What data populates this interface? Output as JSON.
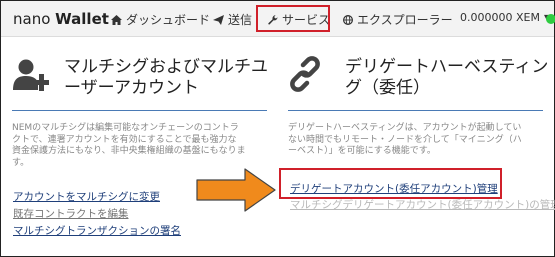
{
  "header": {
    "brand_light": "nano ",
    "brand_bold": "Wallet",
    "nav": {
      "dashboard": "ダッシュボード",
      "send": "送信",
      "services": "サービス",
      "explorer": "エクスプローラー",
      "balance": "0.000000 XEM"
    }
  },
  "left": {
    "title_line1": "マルチシグおよびマルチユ",
    "title_line2": "ーザーアカウント",
    "desc_lines": [
      "NEMのマルチシグは編集可能なオンチェーンのコントラ",
      "クトで、連署アカウントを有効にすることで最も強力な",
      "資金保護方法にもなり、非中央集権組織の基盤にもなりま",
      "す。"
    ],
    "links": {
      "convert": "アカウントをマルチシグに変更",
      "edit": "既存コントラクトを編集",
      "sign": "マルチシグトランザクションの署名"
    }
  },
  "right": {
    "title_line1": "デリゲートハーベスティン",
    "title_line2": "グ（委任）",
    "desc_lines": [
      "デリゲートハーベスティングは、アカウントが起動してい",
      "ない時間でもリモート・ノードを介して「マイニング（ハ",
      "ーベスト）」を可能にする機能です。"
    ],
    "links": {
      "manage": "デリゲートアカウント(委任アカウント)管理",
      "hidden": "マルチシグデリゲートアカウント(委任アカウント)の管理"
    }
  },
  "colors": {
    "highlight": "#d0202a",
    "arrow": "#f08a1c",
    "link": "#1f3f7a",
    "separator": "#4a7ab5",
    "status": "#2ecc40"
  }
}
